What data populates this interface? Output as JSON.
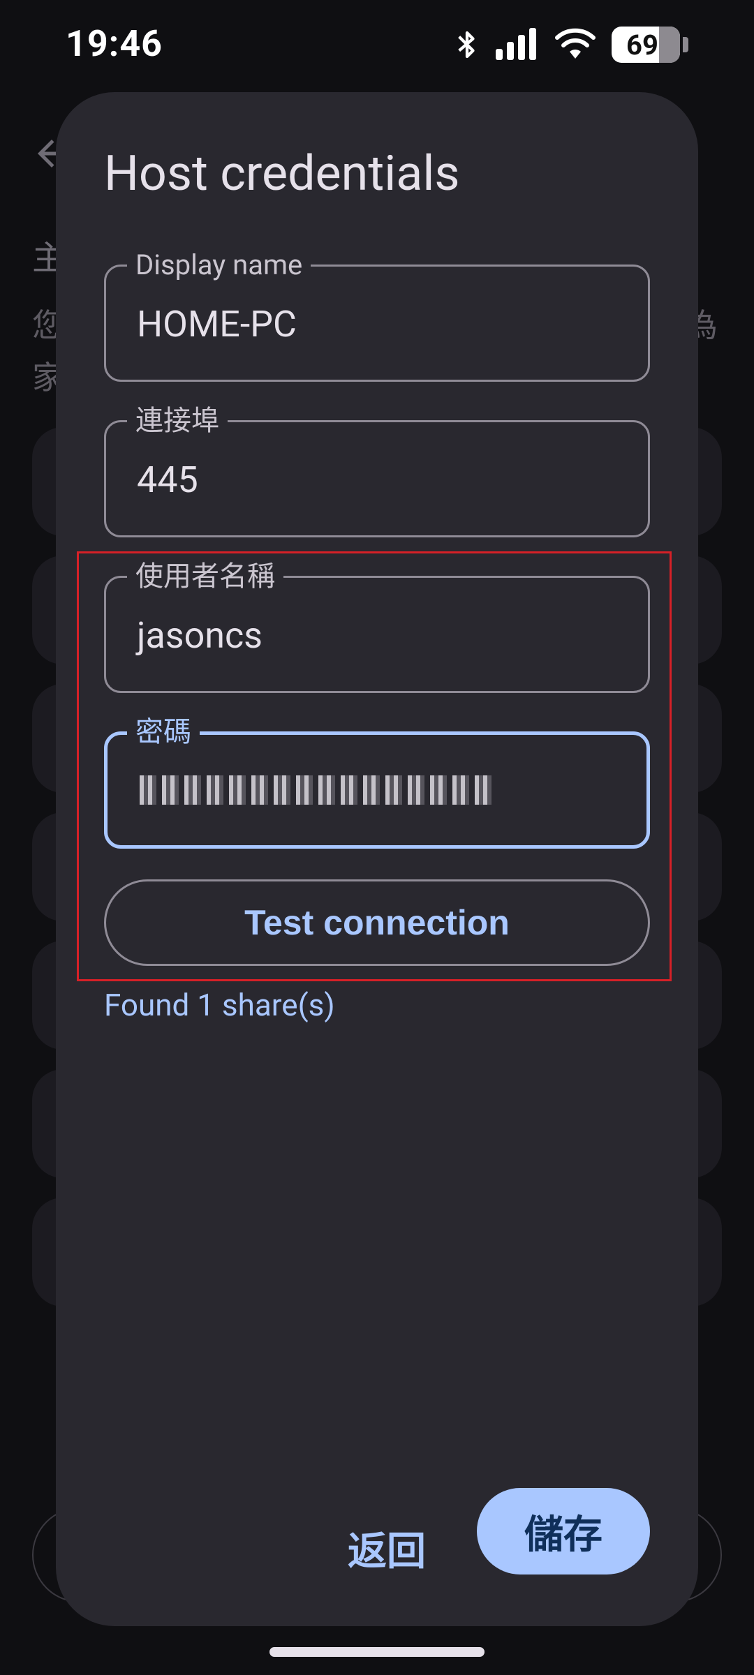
{
  "status_bar": {
    "time": "19:46",
    "battery": "69",
    "icons": [
      "bluetooth-icon",
      "signal-icon",
      "wifi-icon",
      "battery-icon"
    ]
  },
  "background": {
    "back_icon": "arrow-left-icon",
    "title_fragment": "主",
    "text_fragment_1": "您",
    "text_fragment_2": "家",
    "text_fragment_right": "為"
  },
  "dialog": {
    "title": "Host credentials",
    "fields": {
      "display_name": {
        "label": "Display name",
        "value": "HOME-PC"
      },
      "port": {
        "label": "連接埠",
        "value": "445"
      },
      "username": {
        "label": "使用者名稱",
        "value": "jasoncs"
      },
      "password": {
        "label": "密碼"
      }
    },
    "test_button": "Test connection",
    "status_message": "Found 1 share(s)",
    "back_button": "返回",
    "save_button": "儲存"
  },
  "colors": {
    "accent": "#a9c7ff",
    "dialog_bg": "#29282f",
    "highlight": "#d62027"
  }
}
